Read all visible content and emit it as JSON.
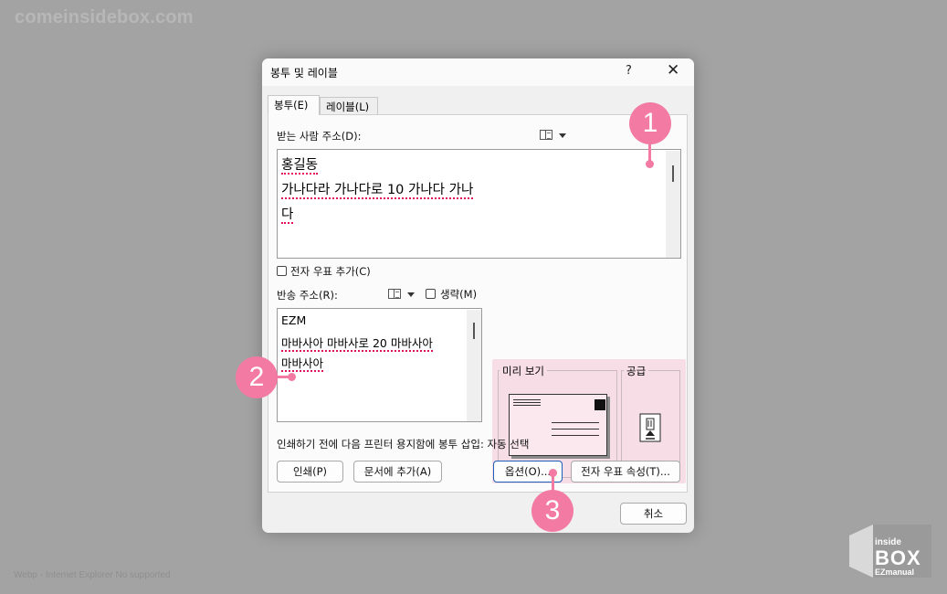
{
  "watermark": {
    "site": "comeinsidebox.com",
    "note": "Webp - Internet Explorer No supported",
    "logo_small": "inside",
    "logo_big": "BOX",
    "logo_sub": "EZmanual"
  },
  "dialog": {
    "title": "봉투 및 레이블",
    "help_label": "?",
    "close_label": "✕",
    "tabs": [
      {
        "label": "봉투(E)",
        "active": true
      },
      {
        "label": "레이블(L)",
        "active": false
      }
    ],
    "recipient": {
      "label": "받는 사람 주소(D):",
      "lines": [
        "홍길동",
        "가나다라 가나다로 10 가나다 가나",
        "다"
      ]
    },
    "epostage_checkbox": "전자 우표 추가(C)",
    "return_address": {
      "label": "반송 주소(R):",
      "omit_checkbox": "생략(M)",
      "lines": [
        "EZM",
        "마바사아 마바사로 20 마바사아",
        "마바사아"
      ]
    },
    "preview": {
      "title": "미리 보기",
      "feed_title": "공급"
    },
    "status_text": "인쇄하기 전에 다음 프린터 용지함에 봉투 삽입: 자동 선택",
    "buttons": {
      "print": "인쇄(P)",
      "add_to_document": "문서에 추가(A)",
      "options": "옵션(O)...",
      "epostage_properties": "전자 우표 속성(T)...",
      "cancel": "취소"
    }
  },
  "markers": [
    "1",
    "2",
    "3"
  ],
  "colors": {
    "marker": "#f27aa3",
    "preview_bg": "#f7dde6",
    "spell_underline": "#e0115f",
    "default_button_border": "#1b5fb6"
  }
}
